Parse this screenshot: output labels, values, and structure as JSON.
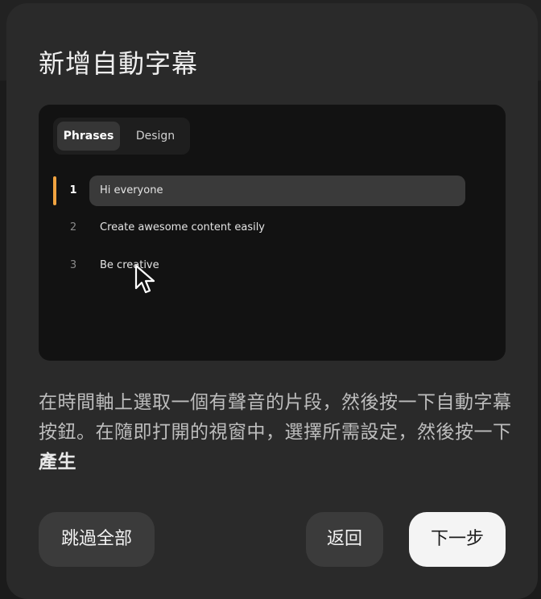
{
  "dialog": {
    "title": "新增自動字幕",
    "description_prefix": "在時間軸上選取一個有聲音的片段，然後按一下自動字幕按鈕。在隨即打開的視窗中，選擇所需設定，然後按一下",
    "description_emphasis": "產生"
  },
  "preview": {
    "tabs": [
      {
        "label": "Phrases",
        "active": true
      },
      {
        "label": "Design",
        "active": false
      }
    ],
    "phrases": [
      {
        "number": "1",
        "text": "Hi everyone",
        "selected": true
      },
      {
        "number": "2",
        "text": "Create awesome content easily",
        "selected": false
      },
      {
        "number": "3",
        "text": "Be creative",
        "selected": false
      }
    ],
    "accent_color": "#f0a340"
  },
  "buttons": {
    "skip_all": "跳過全部",
    "back": "返回",
    "next": "下一步"
  }
}
